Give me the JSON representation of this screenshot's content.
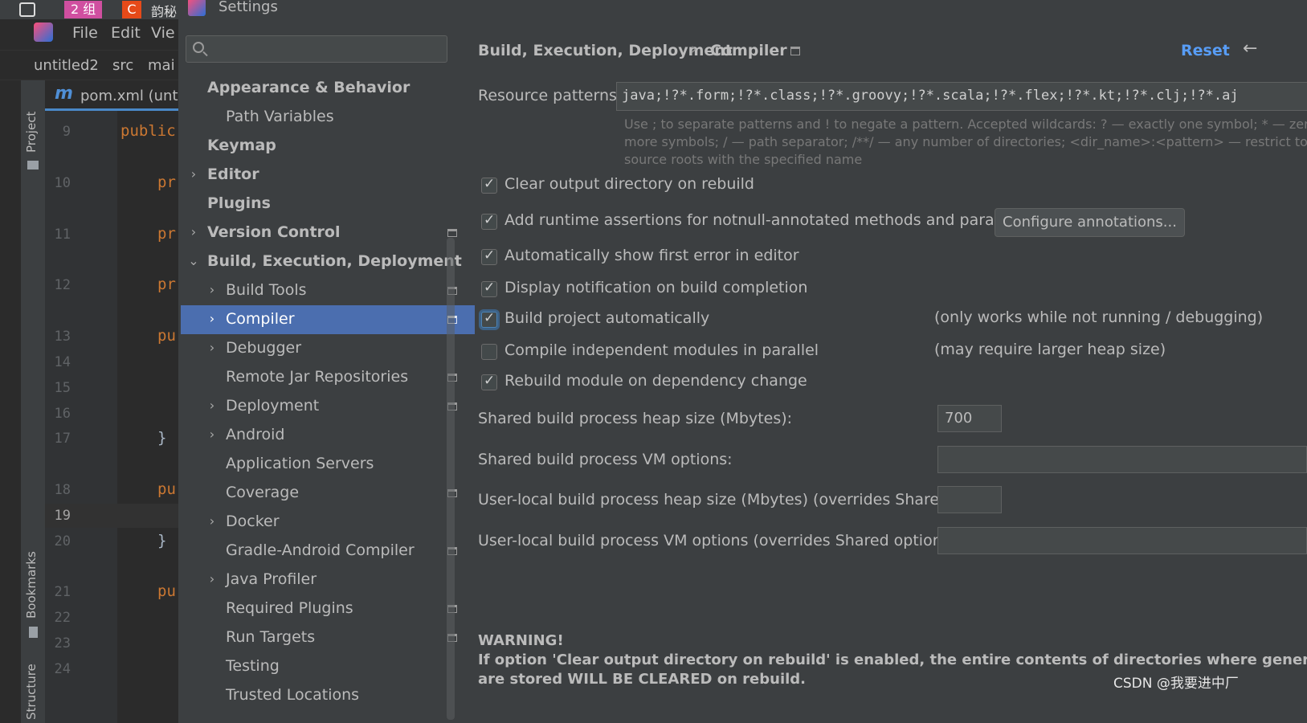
{
  "taskbar": {
    "tab1": "2 组",
    "tab2": "韵秘"
  },
  "dialog_title": "Settings",
  "ide": {
    "menu": [
      "File",
      "Edit",
      "Vie"
    ],
    "breadcrumb": [
      "untitled2",
      "src",
      "mai"
    ],
    "file_tab": "pom.xml (unti",
    "side_tools": [
      "Project",
      "Bookmarks",
      "Structure"
    ],
    "lines": [
      "9",
      "10",
      "11",
      "12",
      "13",
      "14",
      "15",
      "16",
      "17",
      "18",
      "19",
      "20",
      "21",
      "22",
      "23",
      "24"
    ],
    "code": {
      "l9": "public",
      "l10": "pr",
      "l11": "pr",
      "l12": "pr",
      "l13": "pu",
      "l17": "}",
      "l18": "pu",
      "l20": "}",
      "l21": "pu"
    }
  },
  "search": {
    "placeholder": ""
  },
  "tree": [
    {
      "label": "Appearance & Behavior",
      "bold": true,
      "indent": 0,
      "arrow": "",
      "page": false
    },
    {
      "label": "Path Variables",
      "bold": false,
      "indent": 1,
      "arrow": "",
      "page": false
    },
    {
      "label": "Keymap",
      "bold": true,
      "indent": 0,
      "arrow": "",
      "page": false
    },
    {
      "label": "Editor",
      "bold": true,
      "indent": 0,
      "arrow": "›",
      "page": false
    },
    {
      "label": "Plugins",
      "bold": true,
      "indent": 0,
      "arrow": "",
      "page": false
    },
    {
      "label": "Version Control",
      "bold": true,
      "indent": 0,
      "arrow": "›",
      "page": true
    },
    {
      "label": "Build, Execution, Deployment",
      "bold": true,
      "indent": 0,
      "arrow": "⌄",
      "page": false
    },
    {
      "label": "Build Tools",
      "bold": false,
      "indent": 1,
      "arrow": "›",
      "page": true
    },
    {
      "label": "Compiler",
      "bold": false,
      "indent": 1,
      "arrow": "›",
      "page": true,
      "selected": true
    },
    {
      "label": "Debugger",
      "bold": false,
      "indent": 1,
      "arrow": "›",
      "page": false
    },
    {
      "label": "Remote Jar Repositories",
      "bold": false,
      "indent": 1,
      "arrow": "",
      "page": true
    },
    {
      "label": "Deployment",
      "bold": false,
      "indent": 1,
      "arrow": "›",
      "page": true
    },
    {
      "label": "Android",
      "bold": false,
      "indent": 1,
      "arrow": "›",
      "page": false
    },
    {
      "label": "Application Servers",
      "bold": false,
      "indent": 1,
      "arrow": "",
      "page": false
    },
    {
      "label": "Coverage",
      "bold": false,
      "indent": 1,
      "arrow": "",
      "page": true
    },
    {
      "label": "Docker",
      "bold": false,
      "indent": 1,
      "arrow": "›",
      "page": false
    },
    {
      "label": "Gradle-Android Compiler",
      "bold": false,
      "indent": 1,
      "arrow": "",
      "page": true
    },
    {
      "label": "Java Profiler",
      "bold": false,
      "indent": 1,
      "arrow": "›",
      "page": false
    },
    {
      "label": "Required Plugins",
      "bold": false,
      "indent": 1,
      "arrow": "",
      "page": true
    },
    {
      "label": "Run Targets",
      "bold": false,
      "indent": 1,
      "arrow": "",
      "page": true
    },
    {
      "label": "Testing",
      "bold": false,
      "indent": 1,
      "arrow": "",
      "page": false
    },
    {
      "label": "Trusted Locations",
      "bold": false,
      "indent": 1,
      "arrow": "",
      "page": false
    }
  ],
  "header": {
    "crumb1": "Build, Execution, Deployment",
    "sep": "›",
    "crumb2": "Compiler",
    "reset": "Reset",
    "back": "←"
  },
  "resource": {
    "label": "Resource patterns:",
    "value": "java;!?*.form;!?*.class;!?*.groovy;!?*.scala;!?*.flex;!?*.kt;!?*.clj;!?*.aj",
    "hint1": "Use ; to separate patterns and ! to negate a pattern. Accepted wildcards: ? — exactly one symbol; * — zero or",
    "hint2": "more symbols; / — path separator; /**/ — any number of directories; <dir_name>:<pattern> — restrict to",
    "hint3": "source roots with the specified name"
  },
  "options": [
    {
      "label": "Clear output directory on rebuild",
      "checked": true
    },
    {
      "label": "Add runtime assertions for notnull-annotated methods and parameters",
      "checked": true
    },
    {
      "label": "Automatically show first error in editor",
      "checked": true
    },
    {
      "label": "Display notification on build completion",
      "checked": true
    },
    {
      "label": "Build project automatically",
      "checked": true,
      "note": "(only works while not running / debugging)"
    },
    {
      "label": "Compile independent modules in parallel",
      "checked": false,
      "note": "(may require larger heap size)"
    },
    {
      "label": "Rebuild module on dependency change",
      "checked": true
    }
  ],
  "configure_button": "Configure annotations...",
  "fields": [
    {
      "label": "Shared build process heap size (Mbytes):",
      "value": "700"
    },
    {
      "label": "Shared build process VM options:",
      "value": ""
    },
    {
      "label": "User-local build process heap size (Mbytes) (overrides Shared size):",
      "value": ""
    },
    {
      "label": "User-local build process VM options (overrides Shared options):",
      "value": ""
    }
  ],
  "warning": {
    "title": "WARNING!",
    "line1": "If option 'Clear output directory on rebuild' is enabled, the entire contents of directories where generated sources",
    "line2": "are stored WILL BE CLEARED on rebuild."
  },
  "watermark": "CSDN @我要进中厂"
}
